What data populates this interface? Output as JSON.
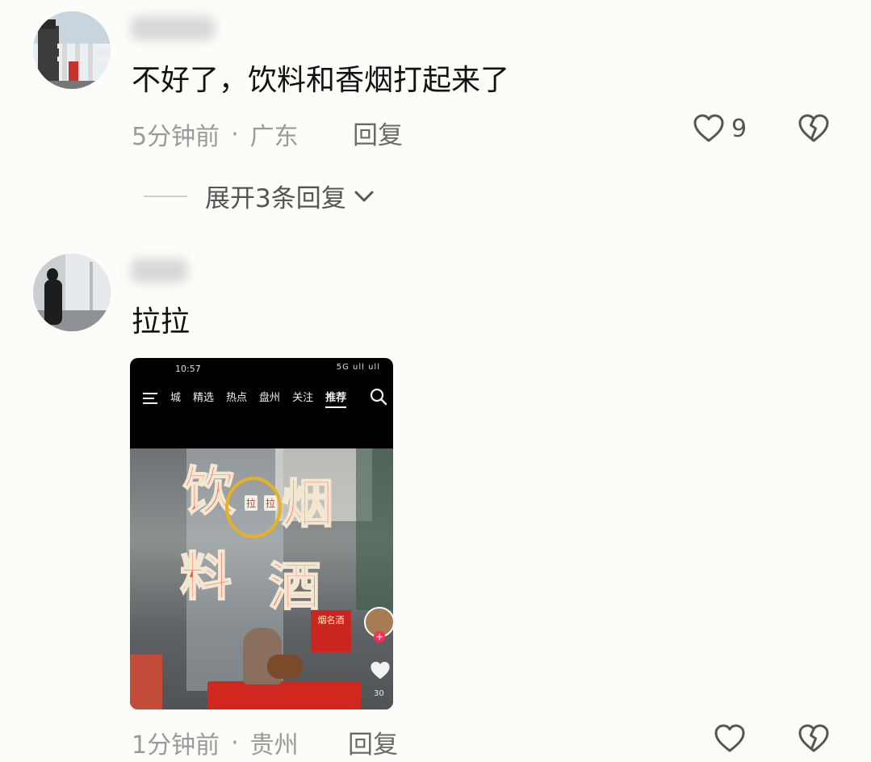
{
  "comments": [
    {
      "text": "不好了，饮料和香烟打起来了",
      "time": "5分钟前",
      "separator": "·",
      "location": "广东",
      "reply_label": "回复",
      "like_count": "9",
      "expand_label": "展开3条回复"
    },
    {
      "text": "拉拉",
      "time": "1分钟前",
      "separator": "·",
      "location": "贵州",
      "reply_label": "回复",
      "like_count": "",
      "attachment": {
        "status_time": "10:57",
        "status_signal": "5G ull ull",
        "nav_tabs": [
          "城",
          "精选",
          "热点",
          "盘州",
          "关注",
          "推荐"
        ],
        "active_tab": "推荐",
        "sign_chars": [
          "饮",
          "烟",
          "料",
          "酒"
        ],
        "circled_chars": [
          "拉",
          "拉"
        ],
        "shop_sign": "烟名酒",
        "mini_count": "30"
      }
    }
  ],
  "icons": {
    "like": "heart-outline-icon",
    "dislike": "broken-heart-icon",
    "expand": "chevron-down-icon",
    "menu": "menu-icon",
    "search": "search-icon"
  },
  "colors": {
    "background": "#fcfcf8",
    "meta_text": "#9a9a9a",
    "sign_red": "#e9533f",
    "highlight_circle": "#e6b124"
  }
}
